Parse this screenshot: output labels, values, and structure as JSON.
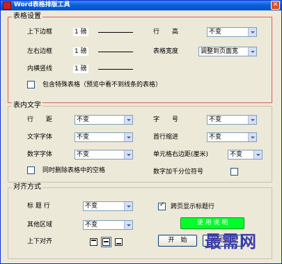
{
  "window": {
    "title": "Word表格排版工具",
    "close_glyph": "✕"
  },
  "table_settings": {
    "legend": "表格设置",
    "top_bottom_margin": {
      "label": "上下边框",
      "value": "1 磅"
    },
    "left_right_margin": {
      "label": "左右边框",
      "value": "1 磅"
    },
    "inner_vertical_line": {
      "label": "内横竖线",
      "value": "1 磅"
    },
    "row_height": {
      "label": "行　　高",
      "value": "不变"
    },
    "table_width": {
      "label": "表格宽度",
      "value": "调整到页面宽"
    },
    "include_special": {
      "label": "包含特殊表格（预览中看不到线条的表格）",
      "checked": false
    }
  },
  "table_text": {
    "legend": "表内文字",
    "line_spacing": {
      "label": "行　　距",
      "value": "不变"
    },
    "font_size": {
      "label": "字　　号",
      "value": "不变"
    },
    "text_font": {
      "label": "文字字体",
      "value": "不变"
    },
    "first_indent": {
      "label": "首行缩进",
      "value": "不变"
    },
    "number_font": {
      "label": "数字字体",
      "value": "不变"
    },
    "cell_margin": {
      "label": "单元格右边距(厘米)",
      "value": "不变"
    },
    "delete_spaces": {
      "label": "同时删除表格中的空格",
      "checked": false
    },
    "thousand_sep": {
      "label": "数字加千分位符号",
      "checked": false
    }
  },
  "alignment": {
    "legend": "对齐方式",
    "title_row": {
      "label": "标 题 行",
      "value": "不变"
    },
    "other_area": {
      "label": "其他区域",
      "value": "不变"
    },
    "vertical_align": {
      "label": "上下对齐"
    },
    "repeat_header": {
      "label": "跨页显示标题行",
      "checked": true
    },
    "help_button": "使 用 说 明",
    "start_button": "开　始",
    "close_button": "关闭退出"
  },
  "watermark": "最需网"
}
